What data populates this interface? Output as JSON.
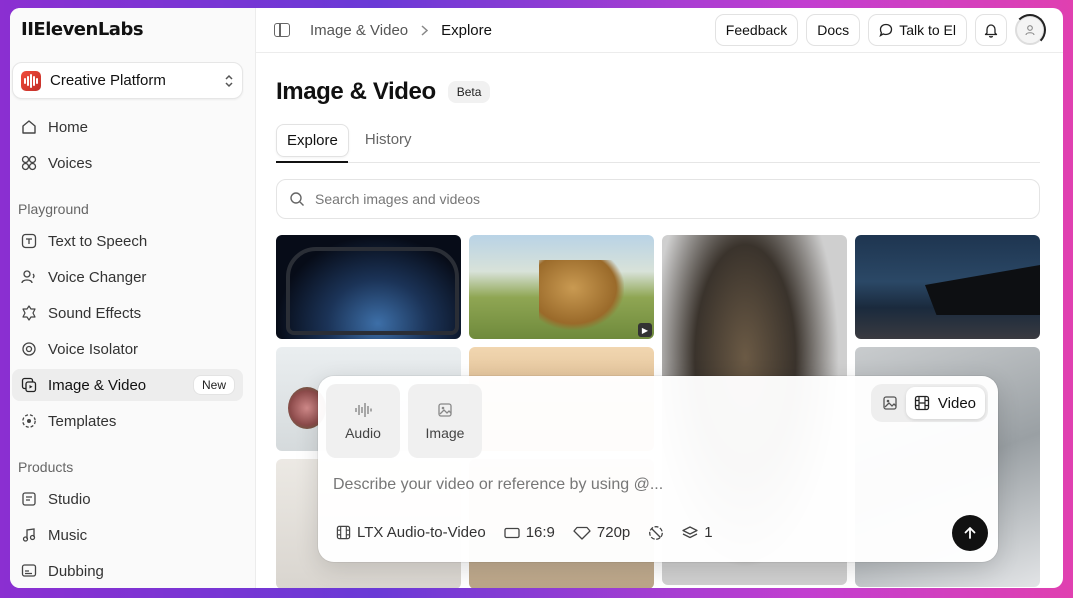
{
  "app": {
    "logo": "IIElevenLabs"
  },
  "sidebar": {
    "platform": "Creative Platform",
    "top_items": [
      {
        "label": "Home"
      },
      {
        "label": "Voices"
      }
    ],
    "playground_label": "Playground",
    "playground_items": [
      {
        "label": "Text to Speech"
      },
      {
        "label": "Voice Changer"
      },
      {
        "label": "Sound Effects"
      },
      {
        "label": "Voice Isolator"
      },
      {
        "label": "Image & Video",
        "badge": "New"
      },
      {
        "label": "Templates"
      }
    ],
    "products_label": "Products",
    "products_items": [
      {
        "label": "Studio"
      },
      {
        "label": "Music"
      },
      {
        "label": "Dubbing"
      }
    ]
  },
  "topbar": {
    "breadcrumb": [
      "Image & Video",
      "Explore"
    ],
    "feedback": "Feedback",
    "docs": "Docs",
    "talk": "Talk to El"
  },
  "page": {
    "title": "Image & Video",
    "badge": "Beta",
    "tabs": [
      "Explore",
      "History"
    ],
    "search_placeholder": "Search images and videos"
  },
  "composer": {
    "modes": [
      "Audio",
      "Image"
    ],
    "switch_video": "Video",
    "prompt_placeholder": "Describe your video or reference by using @...",
    "model": "LTX Audio-to-Video",
    "aspect": "16:9",
    "resolution": "720p",
    "count": "1"
  },
  "colors": {
    "accent": "#111111",
    "badge_bg": "#f1f1f1",
    "bg_gradient_start": "#8b2fd1",
    "bg_gradient_end": "#e040b0"
  }
}
